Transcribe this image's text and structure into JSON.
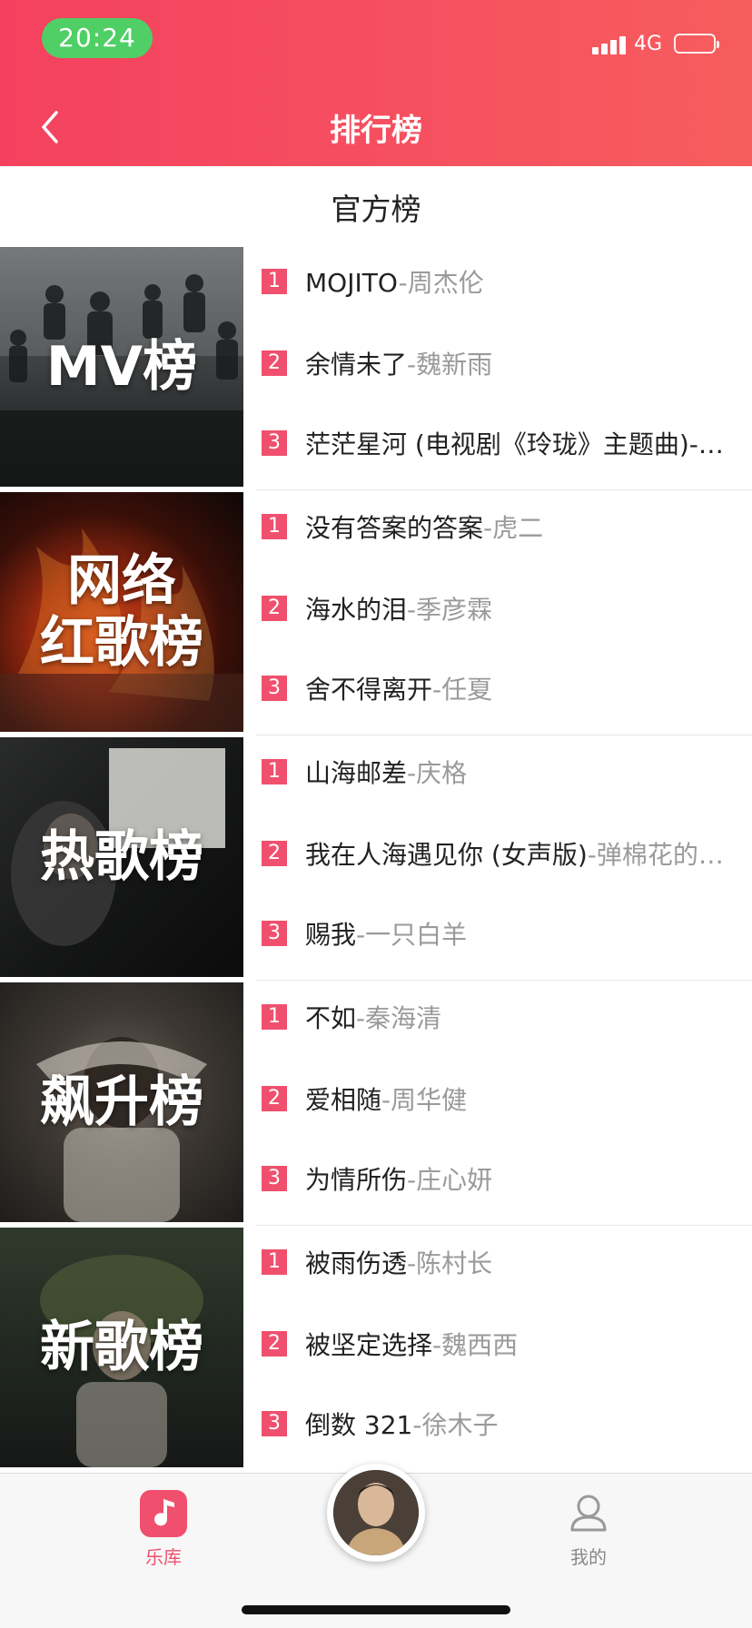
{
  "status": {
    "time": "20:24",
    "network": "4G"
  },
  "header": {
    "title": "排行榜"
  },
  "section": {
    "title": "官方榜"
  },
  "charts": [
    {
      "cover_label": "MV榜",
      "songs": [
        {
          "rank": "1",
          "title": "MOJITO",
          "artist": "-周杰伦"
        },
        {
          "rank": "2",
          "title": "余情未了",
          "artist": "-魏新雨"
        },
        {
          "rank": "3",
          "title": "茫茫星河 (电视剧《玲珑》主题曲)-…",
          "artist": ""
        }
      ]
    },
    {
      "cover_label": "网络\n红歌榜",
      "songs": [
        {
          "rank": "1",
          "title": "没有答案的答案",
          "artist": "-虎二"
        },
        {
          "rank": "2",
          "title": "海水的泪",
          "artist": "-季彦霖"
        },
        {
          "rank": "3",
          "title": "舍不得离开",
          "artist": "-任夏"
        }
      ]
    },
    {
      "cover_label": "热歌榜",
      "songs": [
        {
          "rank": "1",
          "title": "山海邮差",
          "artist": "-庆格"
        },
        {
          "rank": "2",
          "title": "我在人海遇见你 (女声版)",
          "artist": "-弹棉花的…"
        },
        {
          "rank": "3",
          "title": "赐我",
          "artist": "-一只白羊"
        }
      ]
    },
    {
      "cover_label": "飙升榜",
      "songs": [
        {
          "rank": "1",
          "title": "不如",
          "artist": "-秦海清"
        },
        {
          "rank": "2",
          "title": "爱相随",
          "artist": "-周华健"
        },
        {
          "rank": "3",
          "title": "为情所伤",
          "artist": "-庄心妍"
        }
      ]
    },
    {
      "cover_label": "新歌榜",
      "songs": [
        {
          "rank": "1",
          "title": "被雨伤透",
          "artist": "-陈村长"
        },
        {
          "rank": "2",
          "title": "被坚定选择",
          "artist": "-魏西西"
        },
        {
          "rank": "3",
          "title": "倒数 321",
          "artist": "-徐木子"
        }
      ]
    }
  ],
  "tabbar": {
    "library_label": "乐库",
    "me_label": "我的"
  },
  "colors": {
    "accent": "#f0506e",
    "header_start": "#f4415f",
    "header_end": "#f75d5d",
    "status_pill": "#4fcf66"
  },
  "icons": {
    "back": "chevron-left-icon",
    "library": "music-note-icon",
    "me": "user-icon",
    "player": "now-playing-avatar"
  }
}
